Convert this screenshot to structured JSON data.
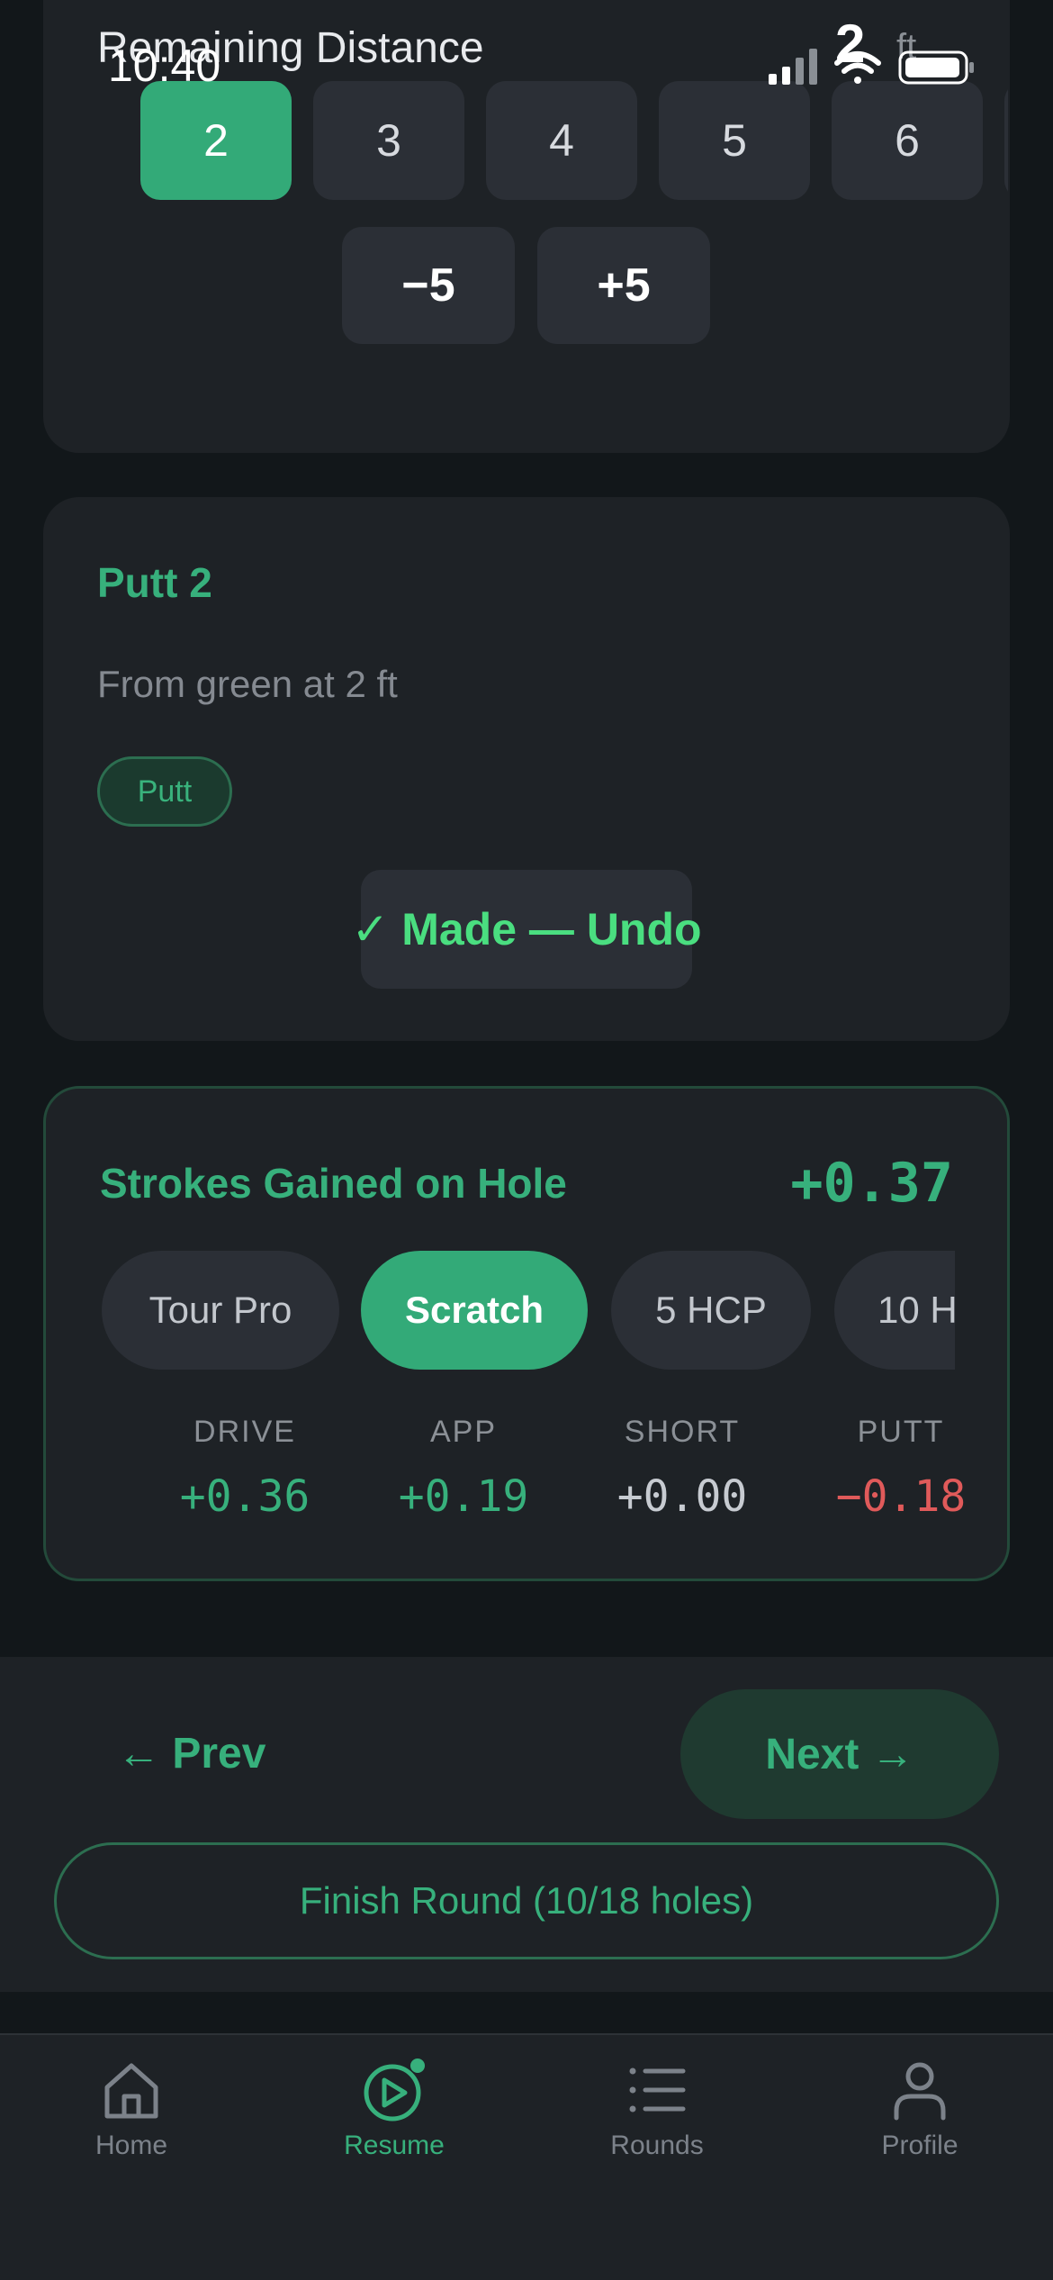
{
  "status_bar": {
    "time": "10:40"
  },
  "distance": {
    "title": "Remaining Distance",
    "value": "2",
    "unit": "ft",
    "options": [
      "2",
      "3",
      "4",
      "5",
      "6"
    ],
    "selected": "2",
    "minus_label": "−5",
    "plus_label": "+5"
  },
  "putt": {
    "title": "Putt 2",
    "subtitle": "From green at 2 ft",
    "tag": "Putt",
    "made_label": "✓ Made — Undo"
  },
  "strokes_gained": {
    "title": "Strokes Gained on Hole",
    "total": "+0.37",
    "levels": [
      "Tour Pro",
      "Scratch",
      "5 HCP",
      "10 H"
    ],
    "selected_level": "Scratch",
    "stats": [
      {
        "label": "DRIVE",
        "value": "+0.36",
        "color": "#37b07c"
      },
      {
        "label": "APP",
        "value": "+0.19",
        "color": "#37b07c"
      },
      {
        "label": "SHORT",
        "value": "+0.00",
        "color": "#c7cbd1"
      },
      {
        "label": "PUTT",
        "value": "−0.18",
        "color": "#e05a5a"
      }
    ]
  },
  "navigation": {
    "prev_label": "← Prev",
    "next_label": "Next →",
    "finish_label": "Finish Round (10/18 holes)"
  },
  "tabbar": {
    "items": [
      {
        "label": "Home",
        "icon": "home-icon"
      },
      {
        "label": "Resume",
        "icon": "play-circle-icon"
      },
      {
        "label": "Rounds",
        "icon": "list-icon"
      },
      {
        "label": "Profile",
        "icon": "person-icon"
      }
    ],
    "active": "Resume"
  },
  "colors": {
    "accent": "#33aa78",
    "background": "#12171a",
    "card": "#1e2226",
    "negative": "#e05a5a"
  }
}
